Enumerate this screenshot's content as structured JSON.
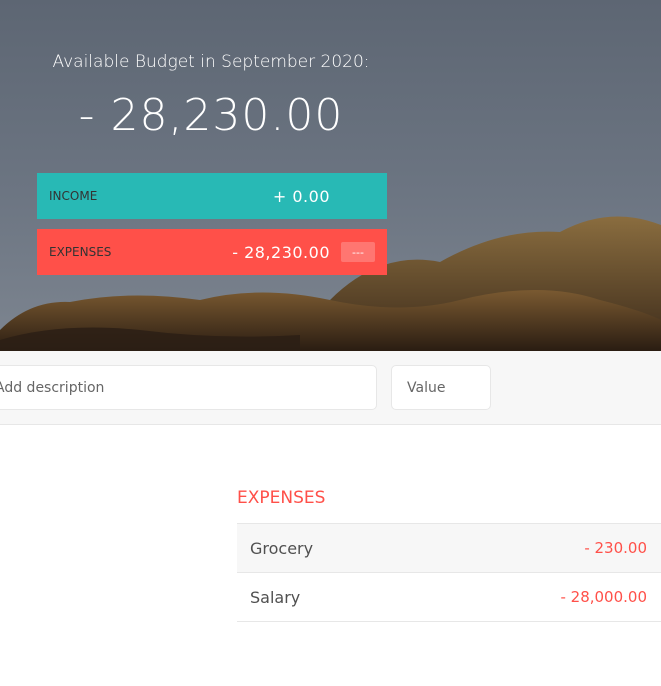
{
  "header": {
    "budget_title": "Available Budget in September 2020:",
    "budget_value": "- 28,230.00",
    "income": {
      "label": "Income",
      "value": "+ 0.00"
    },
    "expenses": {
      "label": "Expenses",
      "value": "- 28,230.00",
      "percentage": "---"
    }
  },
  "add_form": {
    "description_placeholder": "Add description",
    "value_placeholder": "Value"
  },
  "expenses_list": {
    "title": "EXPENSES",
    "items": [
      {
        "description": "Grocery",
        "value": "- 230.00"
      },
      {
        "description": "Salary",
        "value": "- 28,000.00"
      }
    ]
  },
  "colors": {
    "income": "#28b9b5",
    "expenses": "#ff5049"
  }
}
